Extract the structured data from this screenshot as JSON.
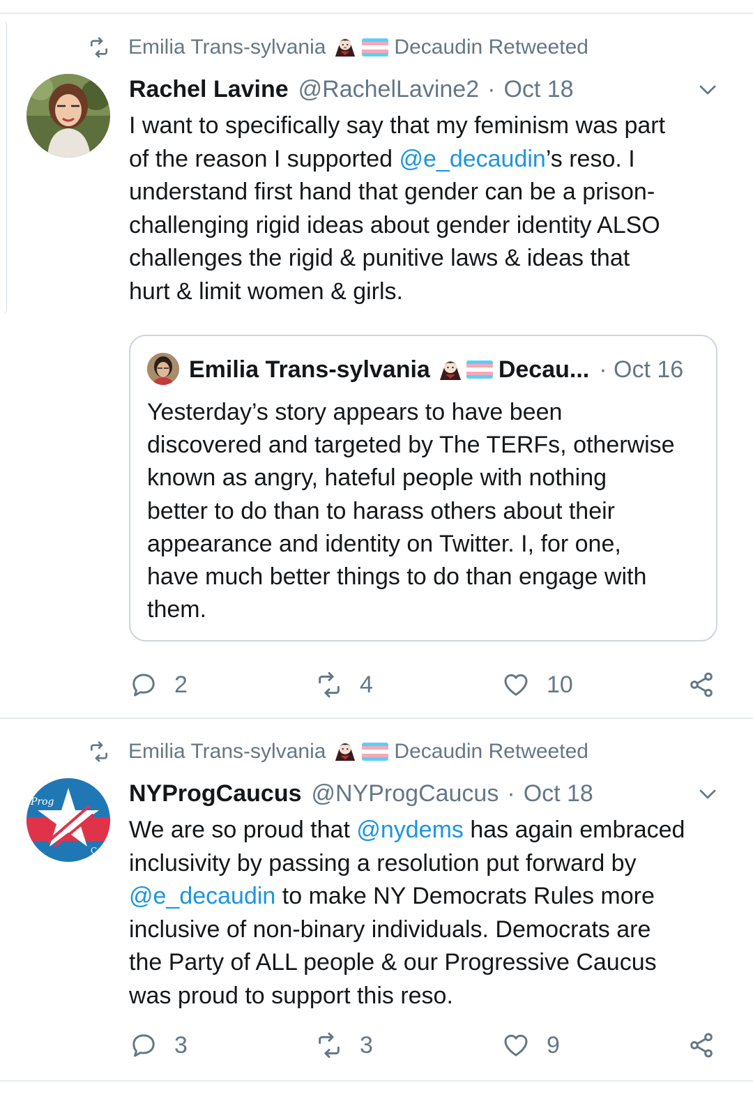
{
  "tweets": [
    {
      "retweeted_by": {
        "name": "Emilia Trans-sylvania",
        "name_suffix": "Decaudin Retweeted",
        "icon": "retweet-icon"
      },
      "author": {
        "display_name": "Rachel Lavine",
        "handle": "@RachelLavine2",
        "separator": "·",
        "date": "Oct 18"
      },
      "body_lines": [
        [
          "I want to specifically say that my feminism was part"
        ],
        [
          "of the reason I supported ",
          "@e_decaudin",
          "’s reso. I"
        ],
        [
          "understand first hand that gender can be a prison-"
        ],
        [
          "challenging rigid ideas about gender identity ALSO"
        ],
        [
          "challenges the rigid & punitive laws  & ideas that"
        ],
        [
          "hurt & limit women & girls."
        ]
      ],
      "quoted": {
        "display_name": "Emilia Trans-sylvania",
        "name_suffix": "Decau...",
        "date": "· Oct 16",
        "body_lines": [
          "Yesterday’s story appears to have been",
          "discovered and targeted by The TERFs, otherwise",
          "known as angry, hateful people with nothing",
          "better to do than to harass others about their",
          "appearance and identity on Twitter. I, for one,",
          "have much better things to do than engage with",
          "them."
        ]
      },
      "actions": {
        "replies": "2",
        "retweets": "4",
        "likes": "10"
      }
    },
    {
      "retweeted_by": {
        "name": "Emilia Trans-sylvania",
        "name_suffix": "Decaudin Retweeted",
        "icon": "retweet-icon"
      },
      "author": {
        "display_name": "NYProgCaucus",
        "handle": "@NYProgCaucus",
        "separator": "·",
        "date": "Oct 18",
        "avatar_text_top": "Prog",
        "avatar_text_bottom": "Cauc"
      },
      "body_lines": [
        [
          "We are so proud that ",
          "@nydems",
          " has again embraced"
        ],
        [
          "inclusivity by passing a resolution put forward by"
        ],
        [
          "@e_decaudin",
          " to make NY Democrats Rules more"
        ],
        [
          "inclusive of non-binary individuals. Democrats are"
        ],
        [
          "the Party of ALL people & our Progressive Caucus"
        ],
        [
          "was proud to support this reso."
        ]
      ],
      "actions": {
        "replies": "3",
        "retweets": "3",
        "likes": "9"
      }
    }
  ],
  "colors": {
    "text": "#14171a",
    "secondary": "#657786",
    "mention": "#1b95e0",
    "divider": "#e6ecf0",
    "quote_border": "#ccd6dd",
    "trans_blue": "#5bcefa",
    "trans_pink": "#f5a9b8"
  }
}
